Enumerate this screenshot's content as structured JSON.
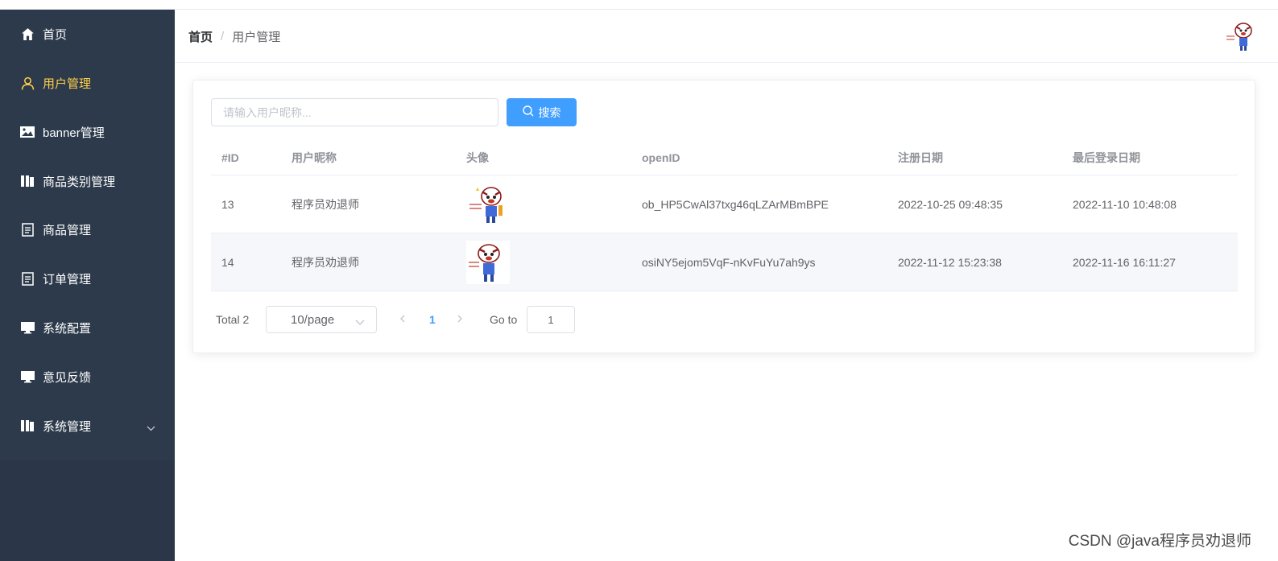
{
  "sidebar": {
    "items": [
      {
        "label": "首页",
        "icon": "home-icon"
      },
      {
        "label": "用户管理",
        "icon": "user-icon",
        "active": true
      },
      {
        "label": "banner管理",
        "icon": "picture-icon"
      },
      {
        "label": "商品类别管理",
        "icon": "category-icon"
      },
      {
        "label": "商品管理",
        "icon": "document-icon"
      },
      {
        "label": "订单管理",
        "icon": "document-icon"
      },
      {
        "label": "系统配置",
        "icon": "monitor-icon"
      },
      {
        "label": "意见反馈",
        "icon": "monitor-icon"
      },
      {
        "label": "系统管理",
        "icon": "category-icon",
        "expandable": true
      }
    ],
    "active_color": "#ffd04b",
    "bg_color": "#2d3a4b"
  },
  "header": {
    "breadcrumb": [
      "首页",
      "用户管理"
    ],
    "separator": "/"
  },
  "search": {
    "placeholder": "请输入用户昵称...",
    "value": "",
    "button_label": "搜索"
  },
  "table": {
    "columns": [
      "#ID",
      "用户昵称",
      "头像",
      "openID",
      "注册日期",
      "最后登录日期"
    ],
    "rows": [
      {
        "id": "13",
        "nickname": "程序员劝退师",
        "openid": "ob_HP5CwAl37txg46qLZArMBmBPE",
        "register_date": "2022-10-25 09:48:35",
        "last_login": "2022-11-10 10:48:08"
      },
      {
        "id": "14",
        "nickname": "程序员劝退师",
        "openid": "osiNY5ejom5VqF-nKvFuYu7ah9ys",
        "register_date": "2022-11-12 15:23:38",
        "last_login": "2022-11-16 16:11:27"
      }
    ]
  },
  "pagination": {
    "total_label": "Total 2",
    "page_size_label": "10/page",
    "current_page": "1",
    "goto_label": "Go to",
    "goto_value": "1"
  },
  "watermark": "CSDN @java程序员劝退师",
  "colors": {
    "primary": "#409eff",
    "sidebar": "#2d3a4b",
    "active": "#ffd04b"
  }
}
